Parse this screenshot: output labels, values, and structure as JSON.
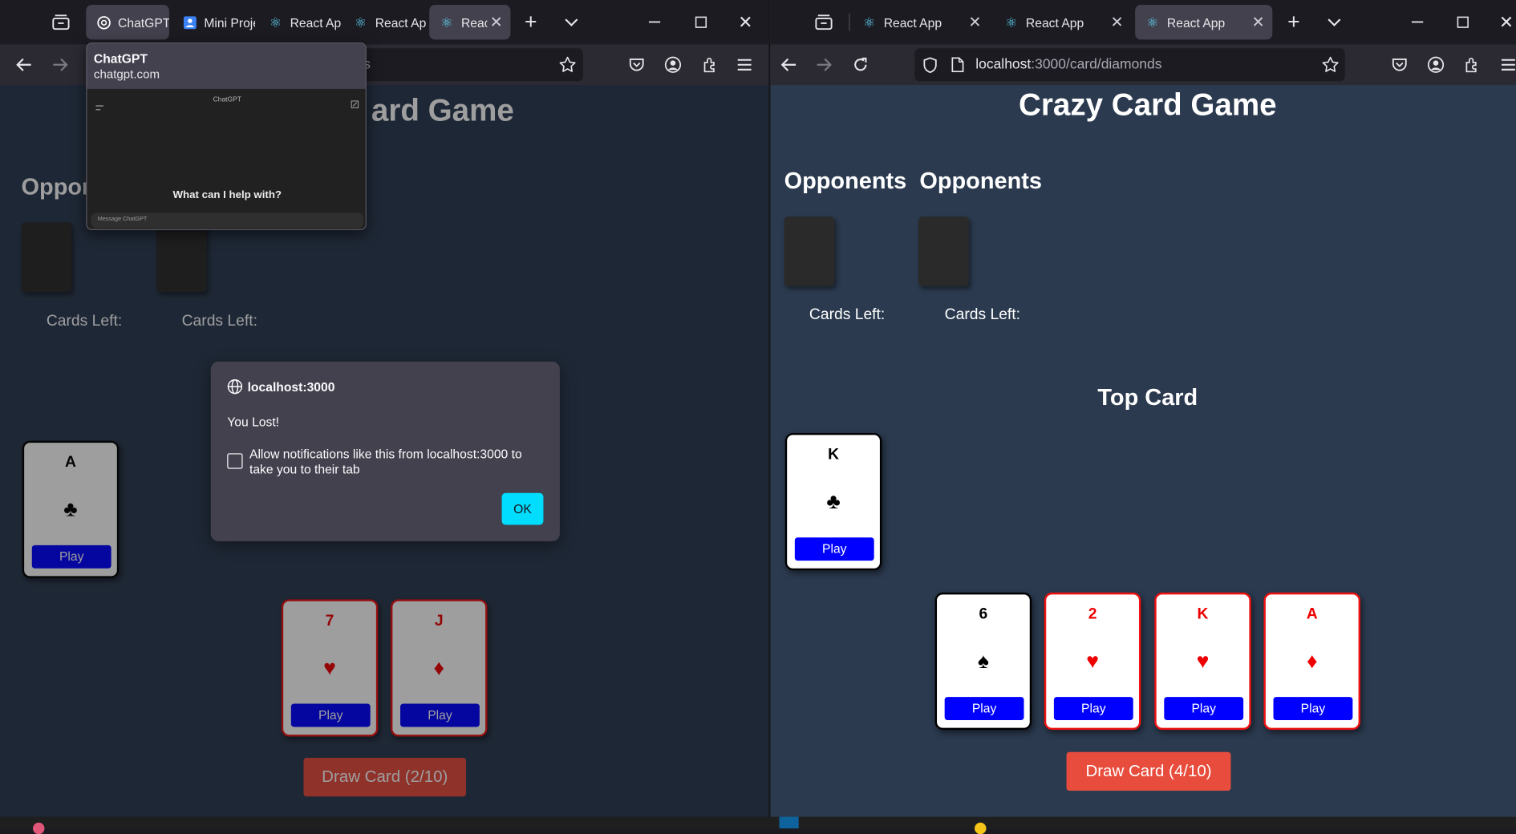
{
  "left_window": {
    "tabs": [
      {
        "title": "ChatGPT",
        "icon": "chatgpt-icon"
      },
      {
        "title": "Mini Projects",
        "icon": "mini-projects-icon"
      },
      {
        "title": "React App",
        "icon": "react-icon"
      },
      {
        "title": "React App",
        "icon": "react-icon"
      },
      {
        "title": "React App",
        "icon": "react-icon"
      }
    ],
    "url_tail": "ts",
    "tab_preview": {
      "title": "ChatGPT",
      "domain": "chatgpt.com",
      "thumb_header": "ChatGPT",
      "thumb_prompt": "What can I help with?",
      "thumb_input": "Message ChatGPT"
    },
    "game": {
      "title_fragment": "ard Game",
      "opponents_fragment": "Oppon",
      "cards_left_label": "Cards Left:",
      "top_card": {
        "rank": "A",
        "suit": "♣",
        "play_label": "Play"
      },
      "hand": [
        {
          "rank": "7",
          "suit": "♥",
          "play_label": "Play"
        },
        {
          "rank": "J",
          "suit": "♦",
          "play_label": "Play"
        }
      ],
      "draw_label": "Draw Card (2/10)"
    },
    "alert": {
      "origin": "localhost:3000",
      "message": "You Lost!",
      "checkbox_label": "Allow notifications like this from localhost:3000 to take you to their tab",
      "ok_label": "OK"
    }
  },
  "right_window": {
    "tabs": [
      {
        "title": "React App",
        "icon": "react-icon"
      },
      {
        "title": "React App",
        "icon": "react-icon"
      },
      {
        "title": "React App",
        "icon": "react-icon"
      }
    ],
    "url": {
      "host": "localhost",
      "rest": ":3000/card/diamonds"
    },
    "game": {
      "title": "Crazy Card Game",
      "opponents_label": "Opponents",
      "cards_left_label": "Cards Left:",
      "top_card_heading": "Top Card",
      "top_card": {
        "rank": "K",
        "suit": "♣",
        "play_label": "Play"
      },
      "hand": [
        {
          "rank": "6",
          "suit": "♠",
          "play_label": "Play",
          "red": false
        },
        {
          "rank": "2",
          "suit": "♥",
          "play_label": "Play",
          "red": true
        },
        {
          "rank": "K",
          "suit": "♥",
          "play_label": "Play",
          "red": true
        },
        {
          "rank": "A",
          "suit": "♦",
          "play_label": "Play",
          "red": true
        }
      ],
      "draw_label": "Draw Card (4/10)"
    }
  },
  "colors": {
    "page_bg": "#2b3a4f",
    "play_button": "#0000ff",
    "draw_button": "#e74c3c",
    "red_suit": "#e00000",
    "ok_button": "#00ddff"
  }
}
